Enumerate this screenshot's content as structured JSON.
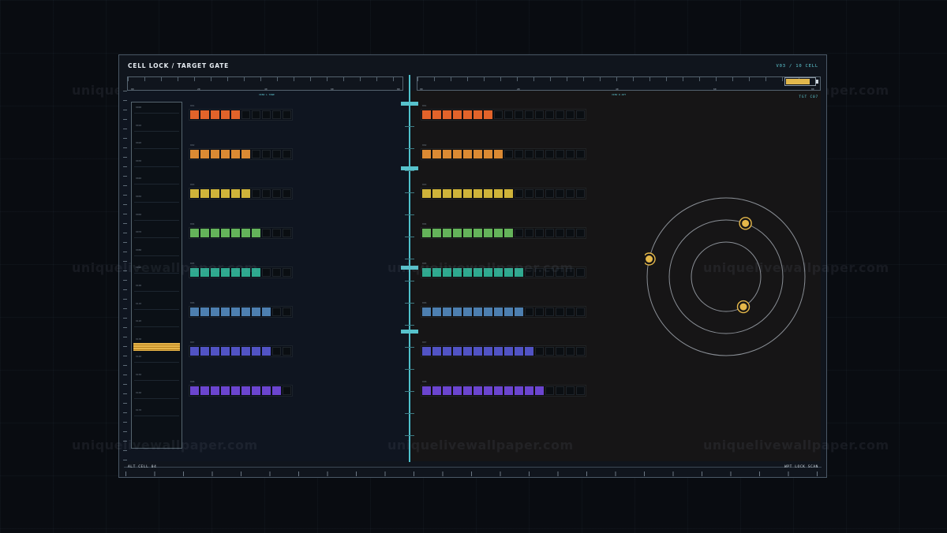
{
  "header": {
    "title": "CELL LOCK / TARGET GATE",
    "readout": "V03 / 10  CELL",
    "sub_readout": "TGT C07"
  },
  "footer": {
    "left": "ALT CELL 04",
    "right": "WPT LOCK SCAN"
  },
  "rulers": {
    "left": [
      "00",
      "20",
      "40",
      "60",
      "80"
    ],
    "left_center_label": "VIEW L TONE",
    "right": [
      "00",
      "20",
      "40",
      "60",
      "80"
    ],
    "right_center_label": "VIEW R APT"
  },
  "status": {
    "battery_fraction": 0.82,
    "battery_color": "#e2b84c"
  },
  "watermark": "uniquelivewallpaper.com",
  "lane": {
    "labels": [
      "0000",
      "0010",
      "0020",
      "0030",
      "0040",
      "0050",
      "0060",
      "0070",
      "0080",
      "0090",
      "0100",
      "0110",
      "0120",
      "0130",
      "0140",
      "0150",
      "0160",
      "0170"
    ],
    "marker_color": "#e7b54a"
  },
  "rows": [
    {
      "label": "001",
      "color": "#e2632a",
      "left": {
        "on": 5,
        "total": 10
      },
      "right": {
        "on": 7,
        "total": 16
      }
    },
    {
      "label": "002",
      "color": "#db8a33",
      "left": {
        "on": 6,
        "total": 10
      },
      "right": {
        "on": 8,
        "total": 16
      }
    },
    {
      "label": "003",
      "color": "#cfb43a",
      "left": {
        "on": 6,
        "total": 10
      },
      "right": {
        "on": 9,
        "total": 16
      }
    },
    {
      "label": "004",
      "color": "#64b35a",
      "left": {
        "on": 7,
        "total": 10
      },
      "right": {
        "on": 9,
        "total": 16
      }
    },
    {
      "label": "005",
      "color": "#2ea98f",
      "left": {
        "on": 7,
        "total": 10
      },
      "right": {
        "on": 10,
        "total": 16
      }
    },
    {
      "label": "006",
      "color": "#4d7fb0",
      "left": {
        "on": 8,
        "total": 10
      },
      "right": {
        "on": 10,
        "total": 16
      }
    },
    {
      "label": "007",
      "color": "#5153c4",
      "left": {
        "on": 8,
        "total": 10
      },
      "right": {
        "on": 11,
        "total": 16
      }
    },
    {
      "label": "008",
      "color": "#6b45cf",
      "left": {
        "on": 9,
        "total": 10
      },
      "right": {
        "on": 12,
        "total": 16
      }
    }
  ],
  "orbit": {
    "ring_color": "#8a8f96",
    "target_color": "#e5b84a",
    "targets": [
      {
        "ring": 3,
        "angle_deg": 167
      },
      {
        "ring": 2,
        "angle_deg": 70
      },
      {
        "ring": 1,
        "angle_deg": -60
      }
    ]
  }
}
